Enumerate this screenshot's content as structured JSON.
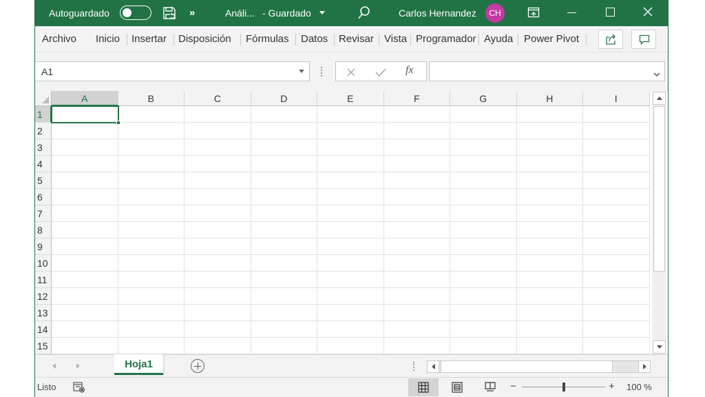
{
  "titlebar": {
    "autosave_label": "Autoguardado",
    "more_label": "»",
    "file_title": "Análi...",
    "saved_status": "- Guardado",
    "user_name": "Carlos Hernandez",
    "user_initials": "CH",
    "colors": {
      "background": "#217346",
      "avatar": "#c43aa3"
    },
    "icons": [
      "toggle-switch",
      "save-sync-icon",
      "search-icon",
      "ribbon-display-icon",
      "minimize-icon",
      "maximize-icon",
      "close-icon"
    ]
  },
  "ribbon": {
    "tabs": [
      "Archivo",
      "Inicio",
      "Insertar",
      "Disposición",
      "Fórmulas",
      "Datos",
      "Revisar",
      "Vista",
      "Programador",
      "Ayuda",
      "Power Pivot"
    ],
    "icons": [
      "share-icon",
      "comments-icon"
    ]
  },
  "formula_bar": {
    "name_box_value": "A1",
    "fx_label": "fx",
    "formula_value": "",
    "icons": [
      "cancel-icon",
      "enter-icon",
      "function-icon"
    ]
  },
  "grid": {
    "columns": [
      "A",
      "B",
      "C",
      "D",
      "E",
      "F",
      "G",
      "H",
      "I"
    ],
    "rows": [
      "1",
      "2",
      "3",
      "4",
      "5",
      "6",
      "7",
      "8",
      "9",
      "10",
      "11",
      "12",
      "13",
      "14",
      "15"
    ],
    "active_cell": "A1",
    "accent_color": "#217346"
  },
  "sheets": {
    "tabs": [
      "Hoja1"
    ],
    "active": "Hoja1"
  },
  "status": {
    "ready_label": "Listo",
    "zoom_minus": "−",
    "zoom_plus": "+",
    "zoom_level": "100 %",
    "zoom_fraction": 0.5,
    "icons": [
      "macro-record-icon",
      "normal-view-icon",
      "page-layout-view-icon",
      "page-break-view-icon"
    ]
  }
}
